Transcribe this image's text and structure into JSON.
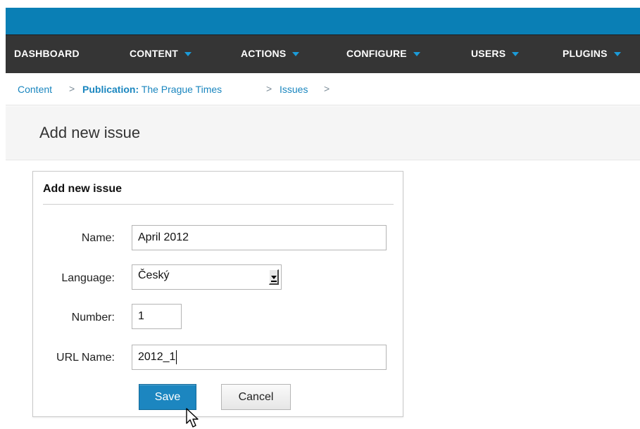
{
  "nav": {
    "items": [
      {
        "label": "DASHBOARD",
        "has_arrow": false
      },
      {
        "label": "CONTENT",
        "has_arrow": true
      },
      {
        "label": "ACTIONS",
        "has_arrow": true
      },
      {
        "label": "CONFIGURE",
        "has_arrow": true
      },
      {
        "label": "USERS",
        "has_arrow": true
      },
      {
        "label": "PLUGINS",
        "has_arrow": true
      }
    ]
  },
  "breadcrumb": {
    "content": "Content",
    "publication_label": "Publication:",
    "publication_name": "The Prague Times",
    "issues": "Issues",
    "separator": ">"
  },
  "page": {
    "title": "Add new issue"
  },
  "form": {
    "panel_title": "Add new issue",
    "name_label": "Name:",
    "name_value": "April 2012",
    "language_label": "Language:",
    "language_value": "Český",
    "number_label": "Number:",
    "number_value": "1",
    "url_label": "URL Name:",
    "url_value": "2012_1",
    "save_label": "Save",
    "cancel_label": "Cancel"
  },
  "colors": {
    "topbar": "#0a7fb5",
    "navbar": "#353535",
    "link": "#1a86bf",
    "primary_button": "#1c86c0"
  }
}
